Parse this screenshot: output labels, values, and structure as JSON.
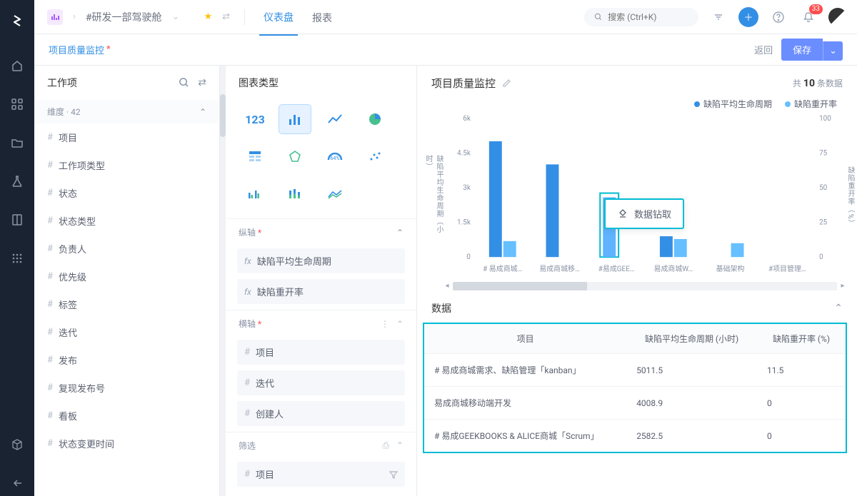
{
  "topbar": {
    "breadcrumb": "#研发一部驾驶舱",
    "tabs": {
      "dashboard": "仪表盘",
      "report": "报表"
    },
    "search_placeholder": "搜索 (Ctrl+K)",
    "notif_count": "33"
  },
  "secondbar": {
    "title": "项目质量监控",
    "back": "返回",
    "save": "保存"
  },
  "left": {
    "title": "工作项",
    "dim_label": "维度",
    "dim_count": "42",
    "items": [
      "项目",
      "工作项类型",
      "状态",
      "状态类型",
      "负责人",
      "优先级",
      "标签",
      "迭代",
      "发布",
      "复现发布号",
      "看板",
      "状态变更时间"
    ]
  },
  "mid": {
    "title": "图表类型",
    "num_label": "123",
    "y_axis_label": "纵轴",
    "y_items": [
      "缺陷平均生命周期",
      "缺陷重开率"
    ],
    "x_axis_label": "横轴",
    "x_items": [
      "项目",
      "迭代",
      "创建人"
    ],
    "filter_label": "筛选",
    "filter_items": [
      "项目"
    ]
  },
  "right": {
    "chart_title": "项目质量监控",
    "count_prefix": "共",
    "count_n": "10",
    "count_suffix": "条数据",
    "legend1": "缺陷平均生命周期",
    "legend2": "缺陷重开率",
    "y_left_label": "缺陷平均生命周期（小时）",
    "y_right_label": "缺陷重开率（%）",
    "drill_label": "数据钻取",
    "data_section": "数据",
    "table": {
      "headers": [
        "项目",
        "缺陷平均生命周期 (小时)",
        "缺陷重开率 (%)"
      ],
      "rows": [
        [
          "# 易成商城需求、缺陷管理「kanban」",
          "5011.5",
          "11.5"
        ],
        [
          "易成商城移动端开发",
          "4008.9",
          "0"
        ],
        [
          "# 易成GEEKBOOKS & ALICE商城「Scrum」",
          "2582.5",
          "0"
        ]
      ]
    }
  },
  "chart_data": {
    "type": "bar",
    "categories": [
      "# 易成商城…",
      "易成商城移…",
      "#易成GEE…",
      "易成商城W…",
      "基础架构",
      "#项目管理…"
    ],
    "y_left_ticks": [
      0,
      1500,
      3000,
      4500,
      6000
    ],
    "y_left_tick_labels": [
      "0",
      "1.5k",
      "3k",
      "4.5k",
      "6k"
    ],
    "y_right_ticks": [
      0,
      25,
      50,
      75,
      100
    ],
    "series": [
      {
        "name": "缺陷平均生命周期",
        "color": "#338fe5",
        "values": [
          5011.5,
          4008.9,
          2582.5,
          900,
          0,
          0
        ]
      },
      {
        "name": "缺陷重开率",
        "color": "#66bfff",
        "values": [
          11.5,
          0,
          0,
          13,
          10,
          0
        ]
      }
    ],
    "highlight_index": 2
  }
}
